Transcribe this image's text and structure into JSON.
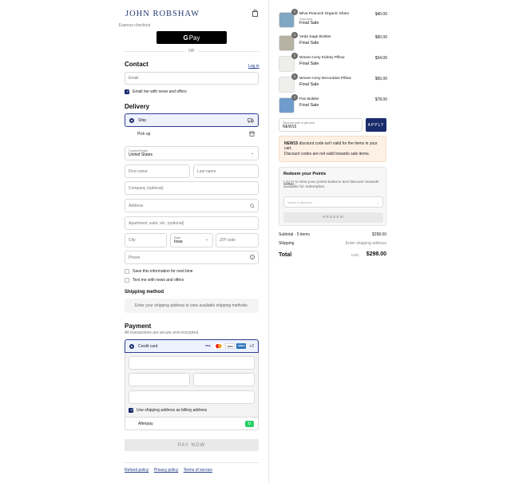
{
  "brand": "JOHN ROBSHAW",
  "express_checkout": "Express checkout",
  "gpay_label": "Pay",
  "or_label": "OR",
  "contact": {
    "title": "Contact",
    "login": "Log in",
    "email_placeholder": "Email",
    "news_label": "Email me with news and offers"
  },
  "delivery": {
    "title": "Delivery",
    "ship_label": "Ship",
    "pickup_label": "Pick up",
    "country_label": "Country/Region",
    "country_value": "United States",
    "first_name": "First name",
    "last_name": "Last name",
    "company": "Company (optional)",
    "address": "Address",
    "apartment": "Apartment, suite, etc. (optional)",
    "city": "City",
    "state_label": "State",
    "state_value": "Iowa",
    "zip": "ZIP code",
    "phone": "Phone",
    "save_info": "Save this information for next time",
    "text_me": "Text me with news and offers"
  },
  "shipping_method": {
    "title": "Shipping method",
    "placeholder": "Enter your shipping address to view available shipping methods."
  },
  "payment": {
    "title": "Payment",
    "subtitle": "All transactions are secure and encrypted.",
    "credit_card": "Credit card",
    "cards": [
      "VISA",
      "MC",
      "DISC",
      "AMEX"
    ],
    "more_cards": "+2",
    "billing_same": "Use shipping address as billing address",
    "afterpay": "Afterpay",
    "pay_now": "PAY NOW"
  },
  "footer": {
    "refund": "Refund policy",
    "privacy": "Privacy policy",
    "terms": "Terms of service"
  },
  "items": [
    {
      "qty": "1",
      "name": "Bilva Peacock Organic Sham",
      "sub": "Standard",
      "final": "Final Sale",
      "price": "$40.00",
      "color": "#7fa6c2"
    },
    {
      "qty": "1",
      "name": "Veda Sage Bolster",
      "sub": "",
      "final": "Final Sale",
      "price": "$90.00",
      "color": "#b7b3a4"
    },
    {
      "qty": "1",
      "name": "Woven Ivory Kidney Pillow",
      "sub": "",
      "final": "Final Sale",
      "price": "$34.00",
      "color": "#eeeeea"
    },
    {
      "qty": "1",
      "name": "Woven Ivory Decorative Pillow",
      "sub": "",
      "final": "Final Sale",
      "price": "$56.00",
      "color": "#efefeb"
    },
    {
      "qty": "1",
      "name": "Pan Bolster",
      "sub": "",
      "final": "Final Sale",
      "price": "$78.00",
      "color": "#6f9ccc"
    }
  ],
  "discount": {
    "label": "Discount code or gift card",
    "value": "NEW15",
    "apply": "APPLY",
    "warn_code": "NEW15",
    "warn_text": " discount code isn't valid for the items in your cart.",
    "warn_text2": "Discount codes are not valid towards sale items."
  },
  "redeem": {
    "title": "Redeem your Points",
    "login": "Log in",
    "text": " to view your points balance and discover rewards available for redemption.",
    "select": "Select a discount",
    "button": "REDEEM"
  },
  "summary": {
    "subtotal_label": "Subtotal · 5 items",
    "subtotal": "$298.00",
    "shipping_label": "Shipping",
    "shipping": "Enter shipping address",
    "total_label": "Total",
    "currency": "USD",
    "total": "$298.00"
  },
  "colors": {
    "accent": "#1a2b6d",
    "brand": "#243a6e",
    "afterpay": "#2ad06a"
  }
}
